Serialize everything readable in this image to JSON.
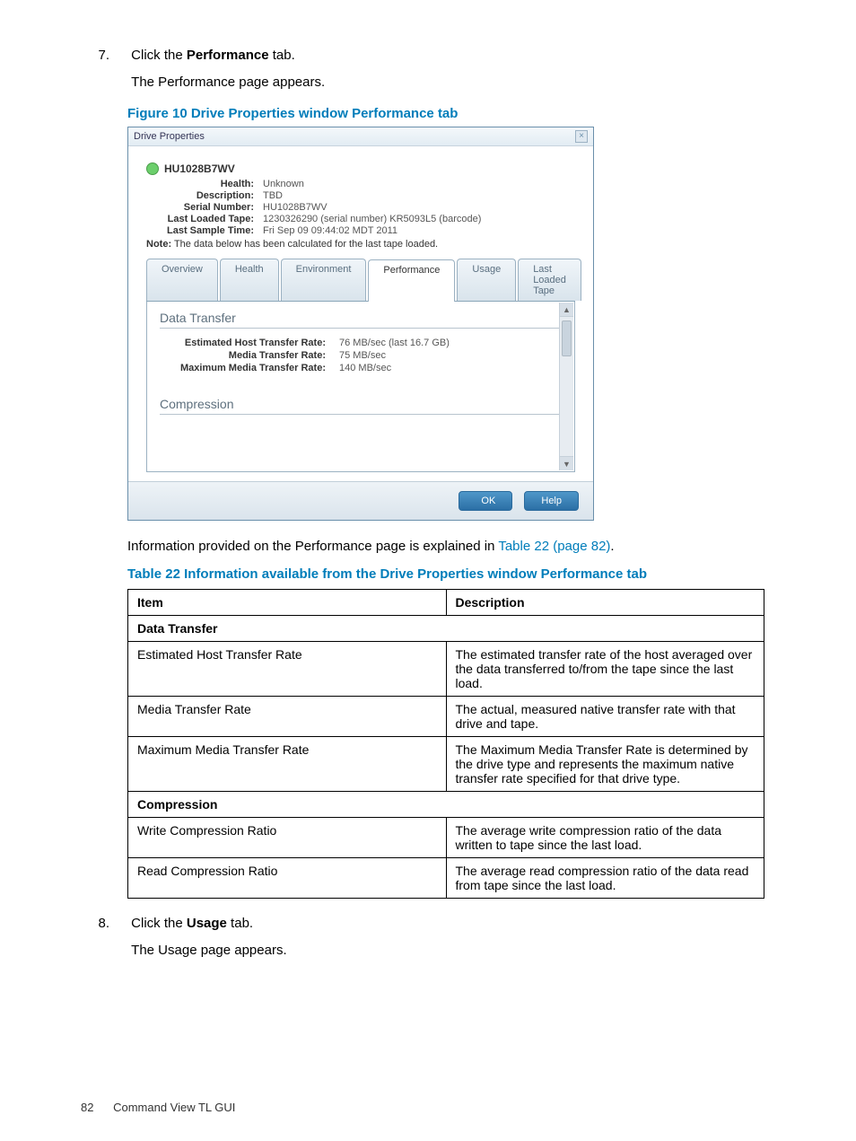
{
  "step7": {
    "num": "7.",
    "line1a": "Click the ",
    "line1b": "Performance",
    "line1c": " tab.",
    "line2": "The Performance page appears."
  },
  "figureCaption": "Figure 10 Drive Properties window Performance tab",
  "dialog": {
    "title": "Drive Properties",
    "deviceName": "HU1028B7WV",
    "fields": {
      "health_k": "Health:",
      "health_v": "Unknown",
      "desc_k": "Description:",
      "desc_v": "TBD",
      "sn_k": "Serial Number:",
      "sn_v": "HU1028B7WV",
      "llt_k": "Last Loaded Tape:",
      "llt_v": "1230326290 (serial number) KR5093L5 (barcode)",
      "lst_k": "Last Sample Time:",
      "lst_v": "Fri Sep 09 09:44:02 MDT 2011"
    },
    "note_b": "Note:",
    "note_t": "  The data below has been calculated for the last tape loaded.",
    "tabs": {
      "t1": "Overview",
      "t2": "Health",
      "t3": "Environment",
      "t4": "Performance",
      "t5": "Usage",
      "t6": "Last Loaded Tape"
    },
    "section1": "Data Transfer",
    "row1_k": "Estimated Host Transfer Rate:",
    "row1_v": "76 MB/sec (last 16.7 GB)",
    "row2_k": "Media Transfer Rate:",
    "row2_v": "75 MB/sec",
    "row3_k": "Maximum Media Transfer Rate:",
    "row3_v": "140 MB/sec",
    "section2": "Compression",
    "btnOk": "OK",
    "btnHelp": "Help"
  },
  "paraAfter_a": "Information provided on the Performance page is explained in ",
  "paraAfter_link": "Table 22 (page 82)",
  "paraAfter_b": ".",
  "tableCaption": "Table 22 Information available from the Drive Properties window Performance tab",
  "table": {
    "hItem": "Item",
    "hDesc": "Description",
    "sec1": "Data Transfer",
    "r1i": "Estimated Host Transfer Rate",
    "r1d": "The estimated transfer rate of the host averaged over the data transferred to/from the tape since the last load.",
    "r2i": "Media Transfer Rate",
    "r2d": "The actual, measured native transfer rate with that drive and tape.",
    "r3i": "Maximum Media Transfer Rate",
    "r3d": "The Maximum Media Transfer Rate is determined by the drive type and represents the maximum native transfer rate specified for that drive type.",
    "sec2": "Compression",
    "r4i": "Write Compression Ratio",
    "r4d": "The average write compression ratio of the data written to tape since the last load.",
    "r5i": "Read Compression Ratio",
    "r5d": "The average read compression ratio of the data read from tape since the last load."
  },
  "step8": {
    "num": "8.",
    "line1a": "Click the ",
    "line1b": "Usage",
    "line1c": " tab.",
    "line2": "The Usage page appears."
  },
  "footer": {
    "page": "82",
    "section": "Command View TL GUI"
  }
}
